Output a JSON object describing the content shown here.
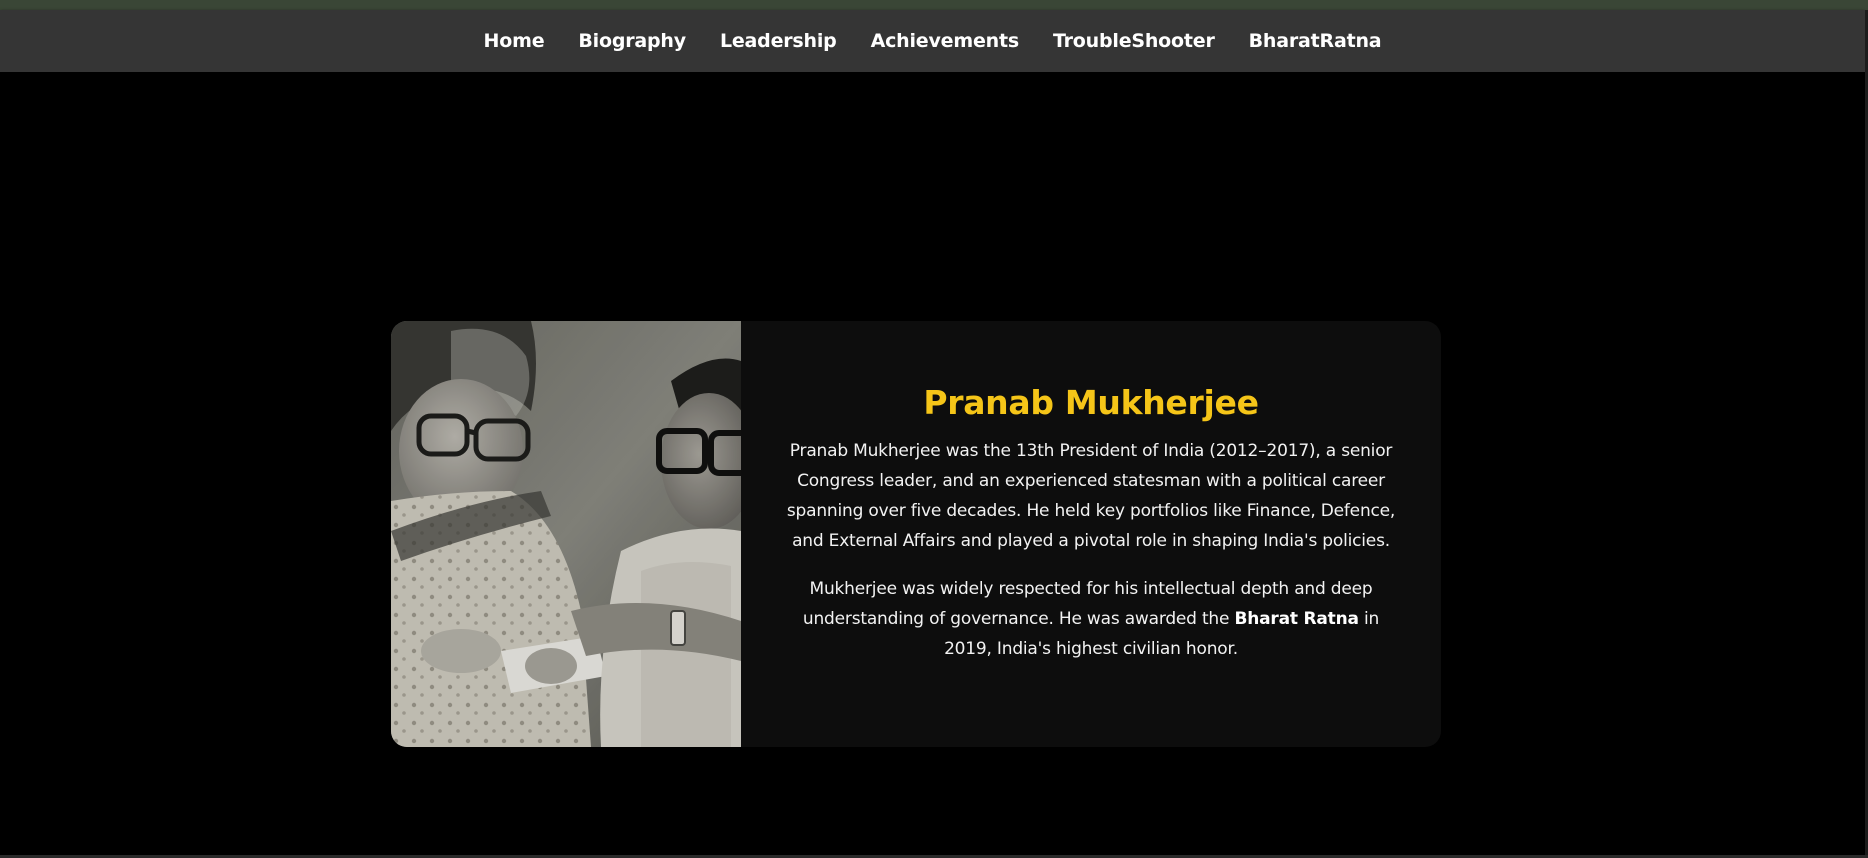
{
  "nav": {
    "items": [
      {
        "label": "Home"
      },
      {
        "label": "Biography"
      },
      {
        "label": "Leadership"
      },
      {
        "label": "Achievements"
      },
      {
        "label": "TroubleShooter"
      },
      {
        "label": "BharatRatna"
      }
    ]
  },
  "card": {
    "title": "Pranab Mukherjee",
    "paragraph1": "Pranab Mukherjee was the 13th President of India (2012–2017), a senior Congress leader, and an experienced statesman with a political career spanning over five decades. He held key portfolios like Finance, Defence, and External Affairs and played a pivotal role in shaping India's policies.",
    "paragraph2_before": "Mukherjee was widely respected for his intellectual depth and deep understanding of governance. He was awarded the ",
    "paragraph2_bold": "Bharat Ratna",
    "paragraph2_after": " in 2019, India's highest civilian honor.",
    "image_icon": "historical-photo"
  },
  "colors": {
    "background": "#000000",
    "navbar": "#353535",
    "card": "#0d0d0d",
    "accent": "#f5c518",
    "text": "#f2f2f2"
  }
}
